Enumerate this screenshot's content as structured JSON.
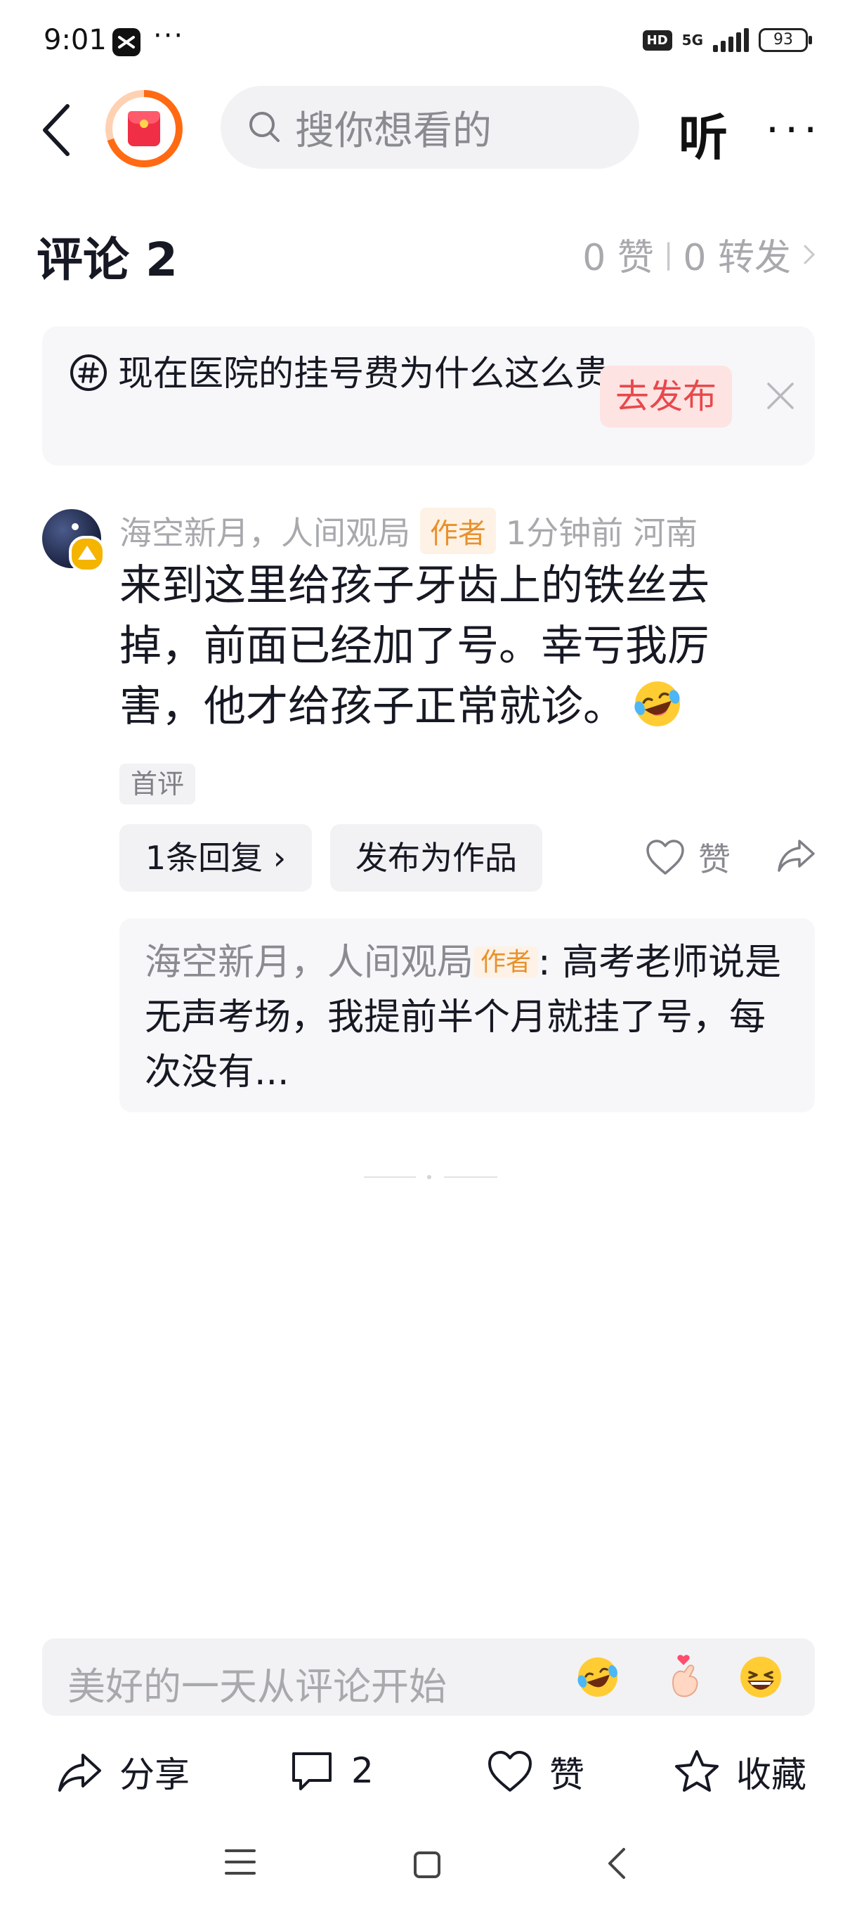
{
  "status_bar": {
    "time": "9:01",
    "more": "···",
    "hd": "HD",
    "network": "5G",
    "battery": "93"
  },
  "header": {
    "search_placeholder": "搜你想看的",
    "listen_label": "听",
    "more_label": "···"
  },
  "comments": {
    "title": "评论 2",
    "likes": "0 赞",
    "separator": "|",
    "reposts": "0 转发",
    "topic": {
      "text": "现在医院的挂号费为什么这么贵",
      "publish_label": "去发布"
    },
    "items": [
      {
        "name": "海空新月，人间观局",
        "author_tag": "作者",
        "time": "1分钟前",
        "location": "河南",
        "body": "来到这里给孩子牙齿上的铁丝去掉，前面已经加了号。幸亏我厉害，他才给孩子正常就诊。",
        "first_tag": "首评",
        "reply_count_label": "1条回复 ›",
        "publish_work_label": "发布为作品",
        "like_label": "赞",
        "reply": {
          "name": "海空新月，人间观局",
          "author_tag": "作者",
          "text": ": 高考老师说是无声考场，我提前半个月就挂了号，每次没有..."
        }
      }
    ]
  },
  "bottom": {
    "input_placeholder": "美好的一天从评论开始",
    "share_label": "分享",
    "comment_count": "2",
    "like_label": "赞",
    "favorite_label": "收藏"
  },
  "colors": {
    "accent_red": "#e8484c",
    "author_tag": "#e8912d",
    "muted_text": "#a8a9ad",
    "chip_bg": "#f2f2f4"
  }
}
